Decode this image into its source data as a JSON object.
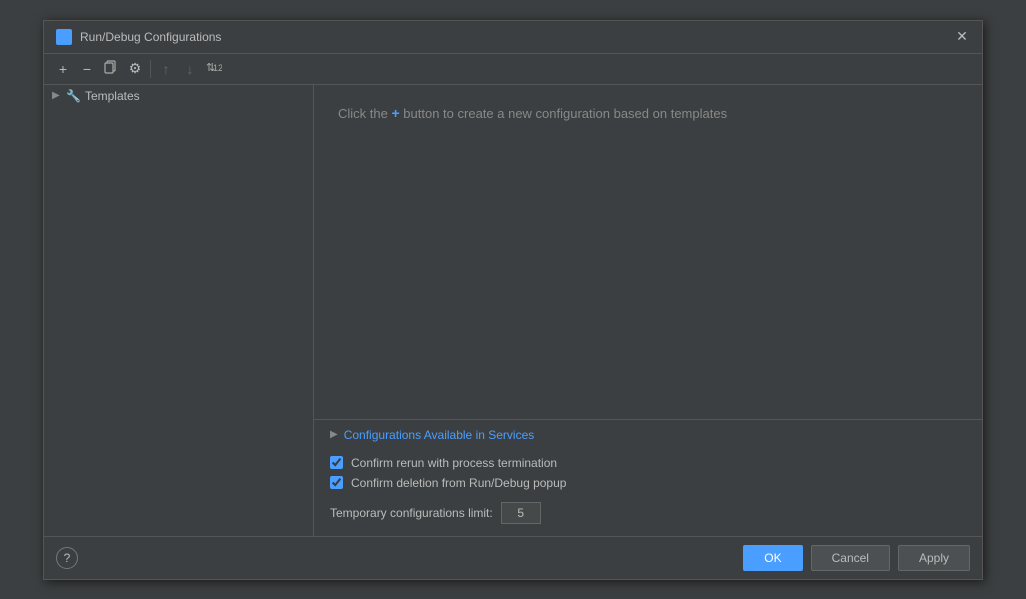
{
  "dialog": {
    "title": "Run/Debug Configurations",
    "icon_label": "R"
  },
  "toolbar": {
    "add_label": "+",
    "remove_label": "−",
    "copy_label": "⧉",
    "settings_label": "⚙",
    "up_label": "↑",
    "down_label": "↓",
    "sort_label": "⇅"
  },
  "tree": {
    "templates_label": "Templates",
    "templates_icon": "🔧"
  },
  "hint": {
    "prefix": "Click the",
    "plus": "+",
    "suffix": "button to create a new configuration based on templates"
  },
  "configurations_section": {
    "label": "Configurations Available in Services"
  },
  "checkboxes": {
    "rerun_label": "Confirm rerun with process termination",
    "rerun_checked": true,
    "deletion_label": "Confirm deletion from Run/Debug popup",
    "deletion_checked": true
  },
  "temp_config": {
    "label": "Temporary configurations limit:",
    "value": "5"
  },
  "footer": {
    "help_label": "?",
    "ok_label": "OK",
    "cancel_label": "Cancel",
    "apply_label": "Apply"
  }
}
